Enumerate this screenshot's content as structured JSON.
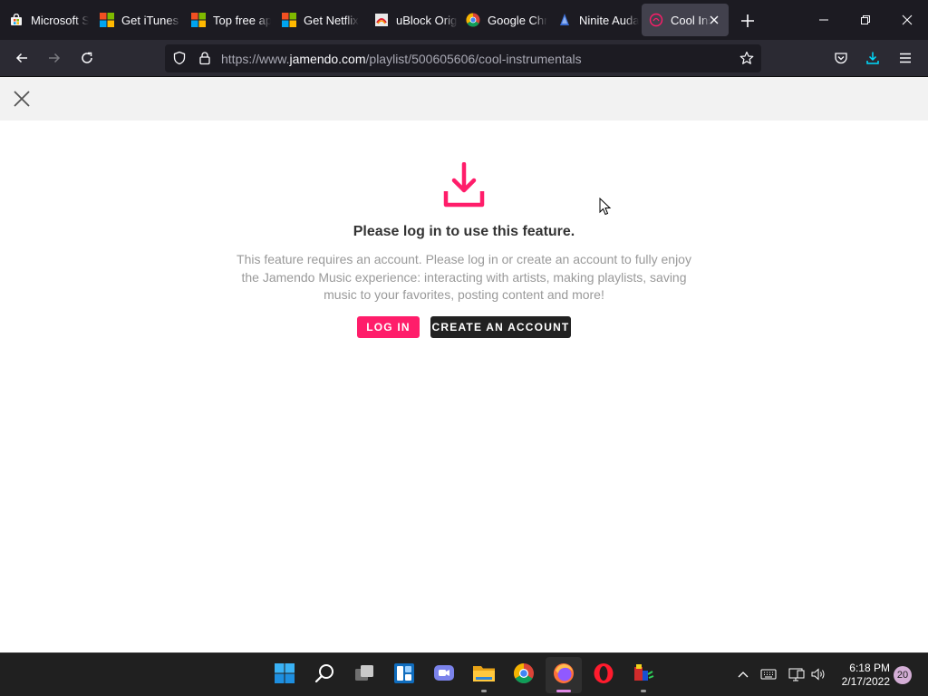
{
  "browser": {
    "tabs": [
      {
        "title": "Microsoft Store",
        "icon": "store-bag-icon"
      },
      {
        "title": "Get iTunes - Microsoft Store",
        "icon": "microsoft-logo-icon"
      },
      {
        "title": "Top free apps",
        "icon": "microsoft-logo-icon"
      },
      {
        "title": "Get Netflix",
        "icon": "microsoft-logo-icon"
      },
      {
        "title": "uBlock Origin",
        "icon": "ublock-icon"
      },
      {
        "title": "Google Chrome",
        "icon": "chrome-icon"
      },
      {
        "title": "Ninite Audacity",
        "icon": "ninite-icon"
      },
      {
        "title": "Cool Instrumentals",
        "icon": "jamendo-icon",
        "active": true
      }
    ],
    "url_prefix": "https://www.",
    "url_domain": "jamendo.com",
    "url_path": "/playlist/500605606/cool-instrumentals"
  },
  "page": {
    "heading": "Please log in to use this feature.",
    "description": "This feature requires an account. Please log in or create an account to fully enjoy the Jamendo Music experience: interacting with artists, making playlists, saving music to your favorites, posting content and more!",
    "login_label": "LOG IN",
    "create_label": "CREATE AN ACCOUNT",
    "accent": "#ff1d6a"
  },
  "taskbar": {
    "apps": [
      "start-icon",
      "search-icon",
      "task-view-icon",
      "widgets-icon",
      "chat-icon",
      "file-explorer-icon",
      "chrome-icon",
      "firefox-icon",
      "opera-icon",
      "app-icon"
    ],
    "time": "6:18 PM",
    "date": "2/17/2022",
    "notifications": "20"
  }
}
